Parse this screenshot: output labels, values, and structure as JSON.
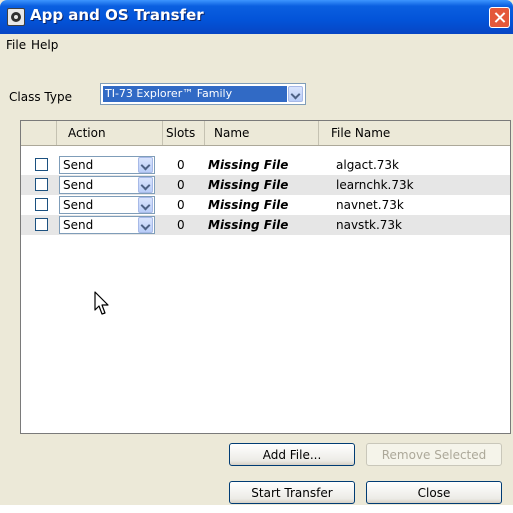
{
  "window": {
    "title": "App and OS Transfer"
  },
  "menu": [
    "File",
    "Help"
  ],
  "class_type": {
    "label": "Class Type",
    "value": "TI-73 Explorer™ Family"
  },
  "table": {
    "columns": [
      "Action",
      "Slots",
      "Name",
      "File Name"
    ],
    "rows": [
      {
        "action": "Send",
        "slots": "0",
        "name": "Missing File",
        "file": "algact.73k"
      },
      {
        "action": "Send",
        "slots": "0",
        "name": "Missing File",
        "file": "learnchk.73k"
      },
      {
        "action": "Send",
        "slots": "0",
        "name": "Missing File",
        "file": "navnet.73k"
      },
      {
        "action": "Send",
        "slots": "0",
        "name": "Missing File",
        "file": "navstk.73k"
      }
    ]
  },
  "buttons": {
    "add_file": "Add File...",
    "remove_selected": "Remove Selected",
    "start_transfer": "Start Transfer",
    "close": "Close"
  }
}
